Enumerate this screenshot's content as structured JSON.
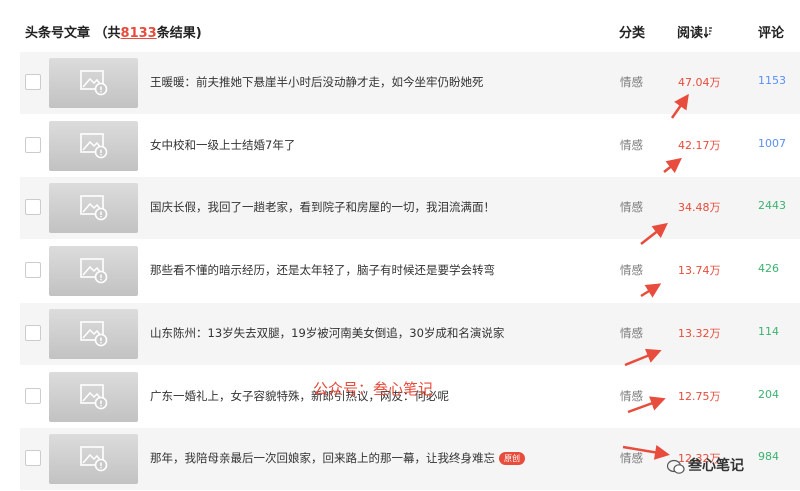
{
  "header": {
    "title_prefix": "头条号文章 （共",
    "result_count": "8133",
    "title_suffix": "条结果)",
    "col_category": "分类",
    "col_reads": "阅读",
    "col_comments": "评论"
  },
  "rows": [
    {
      "title": "王暖暖：前夫推她下悬崖半小时后没动静才走，如今坐牢仍盼她死",
      "category": "情感",
      "reads": "47.04万",
      "comments": "1153"
    },
    {
      "title": "女中校和一级上士结婚7年了",
      "category": "情感",
      "reads": "42.17万",
      "comments": "1007"
    },
    {
      "title": "国庆长假，我回了一趟老家，看到院子和房屋的一切，我泪流满面！",
      "category": "情感",
      "reads": "34.48万",
      "comments": "2443"
    },
    {
      "title": "那些看不懂的暗示经历，还是太年轻了，脑子有时候还是要学会转弯",
      "category": "情感",
      "reads": "13.74万",
      "comments": "426"
    },
    {
      "title": "山东陈州：13岁失去双腿，19岁被河南美女倒追，30岁成和名演说家",
      "category": "情感",
      "reads": "13.32万",
      "comments": "114"
    },
    {
      "title": "广东一婚礼上，女子容貌特殊，新郎引热议，网友：何必呢",
      "category": "情感",
      "reads": "12.75万",
      "comments": "204"
    },
    {
      "title": "那年，我陪母亲最后一次回娘家，回来路上的那一幕，让我终身难忘",
      "badge": "原创",
      "category": "情感",
      "reads": "12.32万",
      "comments": "984"
    }
  ],
  "watermark": "公众号：叁心笔记",
  "brand": "叁心笔记",
  "colors": {
    "reads": "#e74c3c",
    "comments_blue": "#5b8ff9",
    "comments_green": "#3cb371",
    "alt_row": "#f5f5f5"
  }
}
